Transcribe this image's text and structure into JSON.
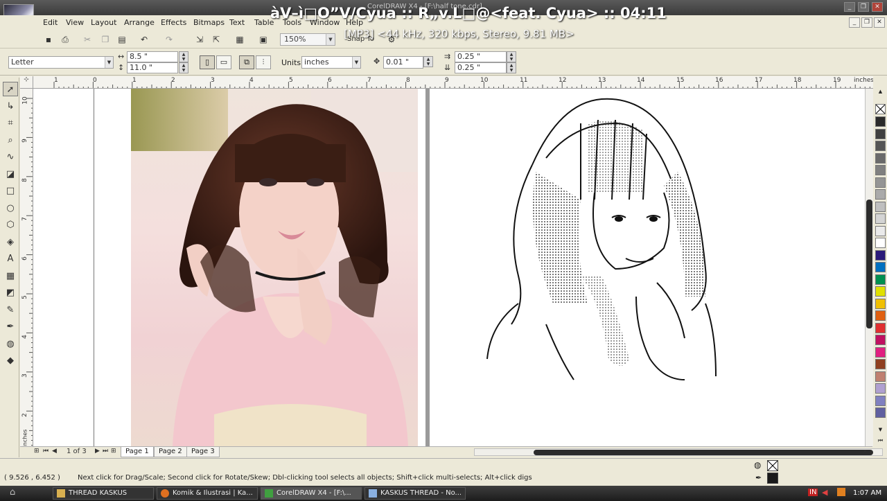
{
  "window": {
    "title": "CorelDRAW X4 - [F:\\half tone.cdr]",
    "overlay_song": "àV–ì□O”V/Cyua :: R„v.L□@<feat. Cyua> :: 04:11",
    "overlay_info": "[MP3] <44 kHz, 320 kbps, Stereo, 9.81 MB>"
  },
  "menu": [
    "Edit",
    "View",
    "Layout",
    "Arrange",
    "Effects",
    "Bitmaps",
    "Text",
    "Table",
    "Tools",
    "Window",
    "Help"
  ],
  "toolbar": {
    "zoom": "150%",
    "snap_to": "Snap To"
  },
  "property_bar": {
    "paper_size": "Letter",
    "width": "8.5 \"",
    "height": "11.0 \"",
    "units_label": "Units:",
    "units": "inches",
    "nudge": "0.01 \"",
    "dup_x": "0.25 \"",
    "dup_y": "0.25 \""
  },
  "ruler": {
    "h_labels": [
      "1",
      "0",
      "1",
      "2",
      "3",
      "4",
      "5",
      "6",
      "7",
      "8",
      "9",
      "10",
      "11",
      "12",
      "13",
      "14",
      "15",
      "16",
      "17",
      "18",
      "19"
    ],
    "unit": "inches",
    "v_labels": [
      "10",
      "9",
      "8",
      "7",
      "6",
      "5",
      "4",
      "3",
      "2"
    ],
    "v_unit": "inches"
  },
  "page_nav": {
    "counter": "1 of 3",
    "pages": [
      "Page 1",
      "Page 2",
      "Page 3"
    ]
  },
  "status": {
    "coords": "( 9.526 , 6.452 )",
    "hint": "Next click for Drag/Scale; Second click for Rotate/Skew; Dbl-clicking tool selects all objects; Shift+click multi-selects; Alt+click digs"
  },
  "taskbar": {
    "items": [
      "THREAD KASKUS",
      "Komik & Ilustrasi | Ka...",
      "CorelDRAW X4 - [F:\\...",
      "KASKUS THREAD - No..."
    ],
    "lang": "IN",
    "clock": "1:07 AM"
  },
  "palette_colors": [
    "#2a2a2a",
    "#404040",
    "#555555",
    "#6a6a6a",
    "#808080",
    "#959595",
    "#aaaaaa",
    "#bfbfbf",
    "#d4d4d4",
    "#eaeaea",
    "#ffffff",
    "#2a1a7a",
    "#0070c0",
    "#009050",
    "#e0e000",
    "#f0c000",
    "#e06010",
    "#e03030",
    "#c01060",
    "#e02080",
    "#904020",
    "#c08070",
    "#b0a0d0",
    "#8080c0",
    "#6060a0"
  ],
  "icons": {
    "pick_tool": "arrow-pointer-icon",
    "shape_tool": "node-edit-icon",
    "crop_tool": "crop-icon",
    "zoom_tool": "magnifier-icon"
  }
}
